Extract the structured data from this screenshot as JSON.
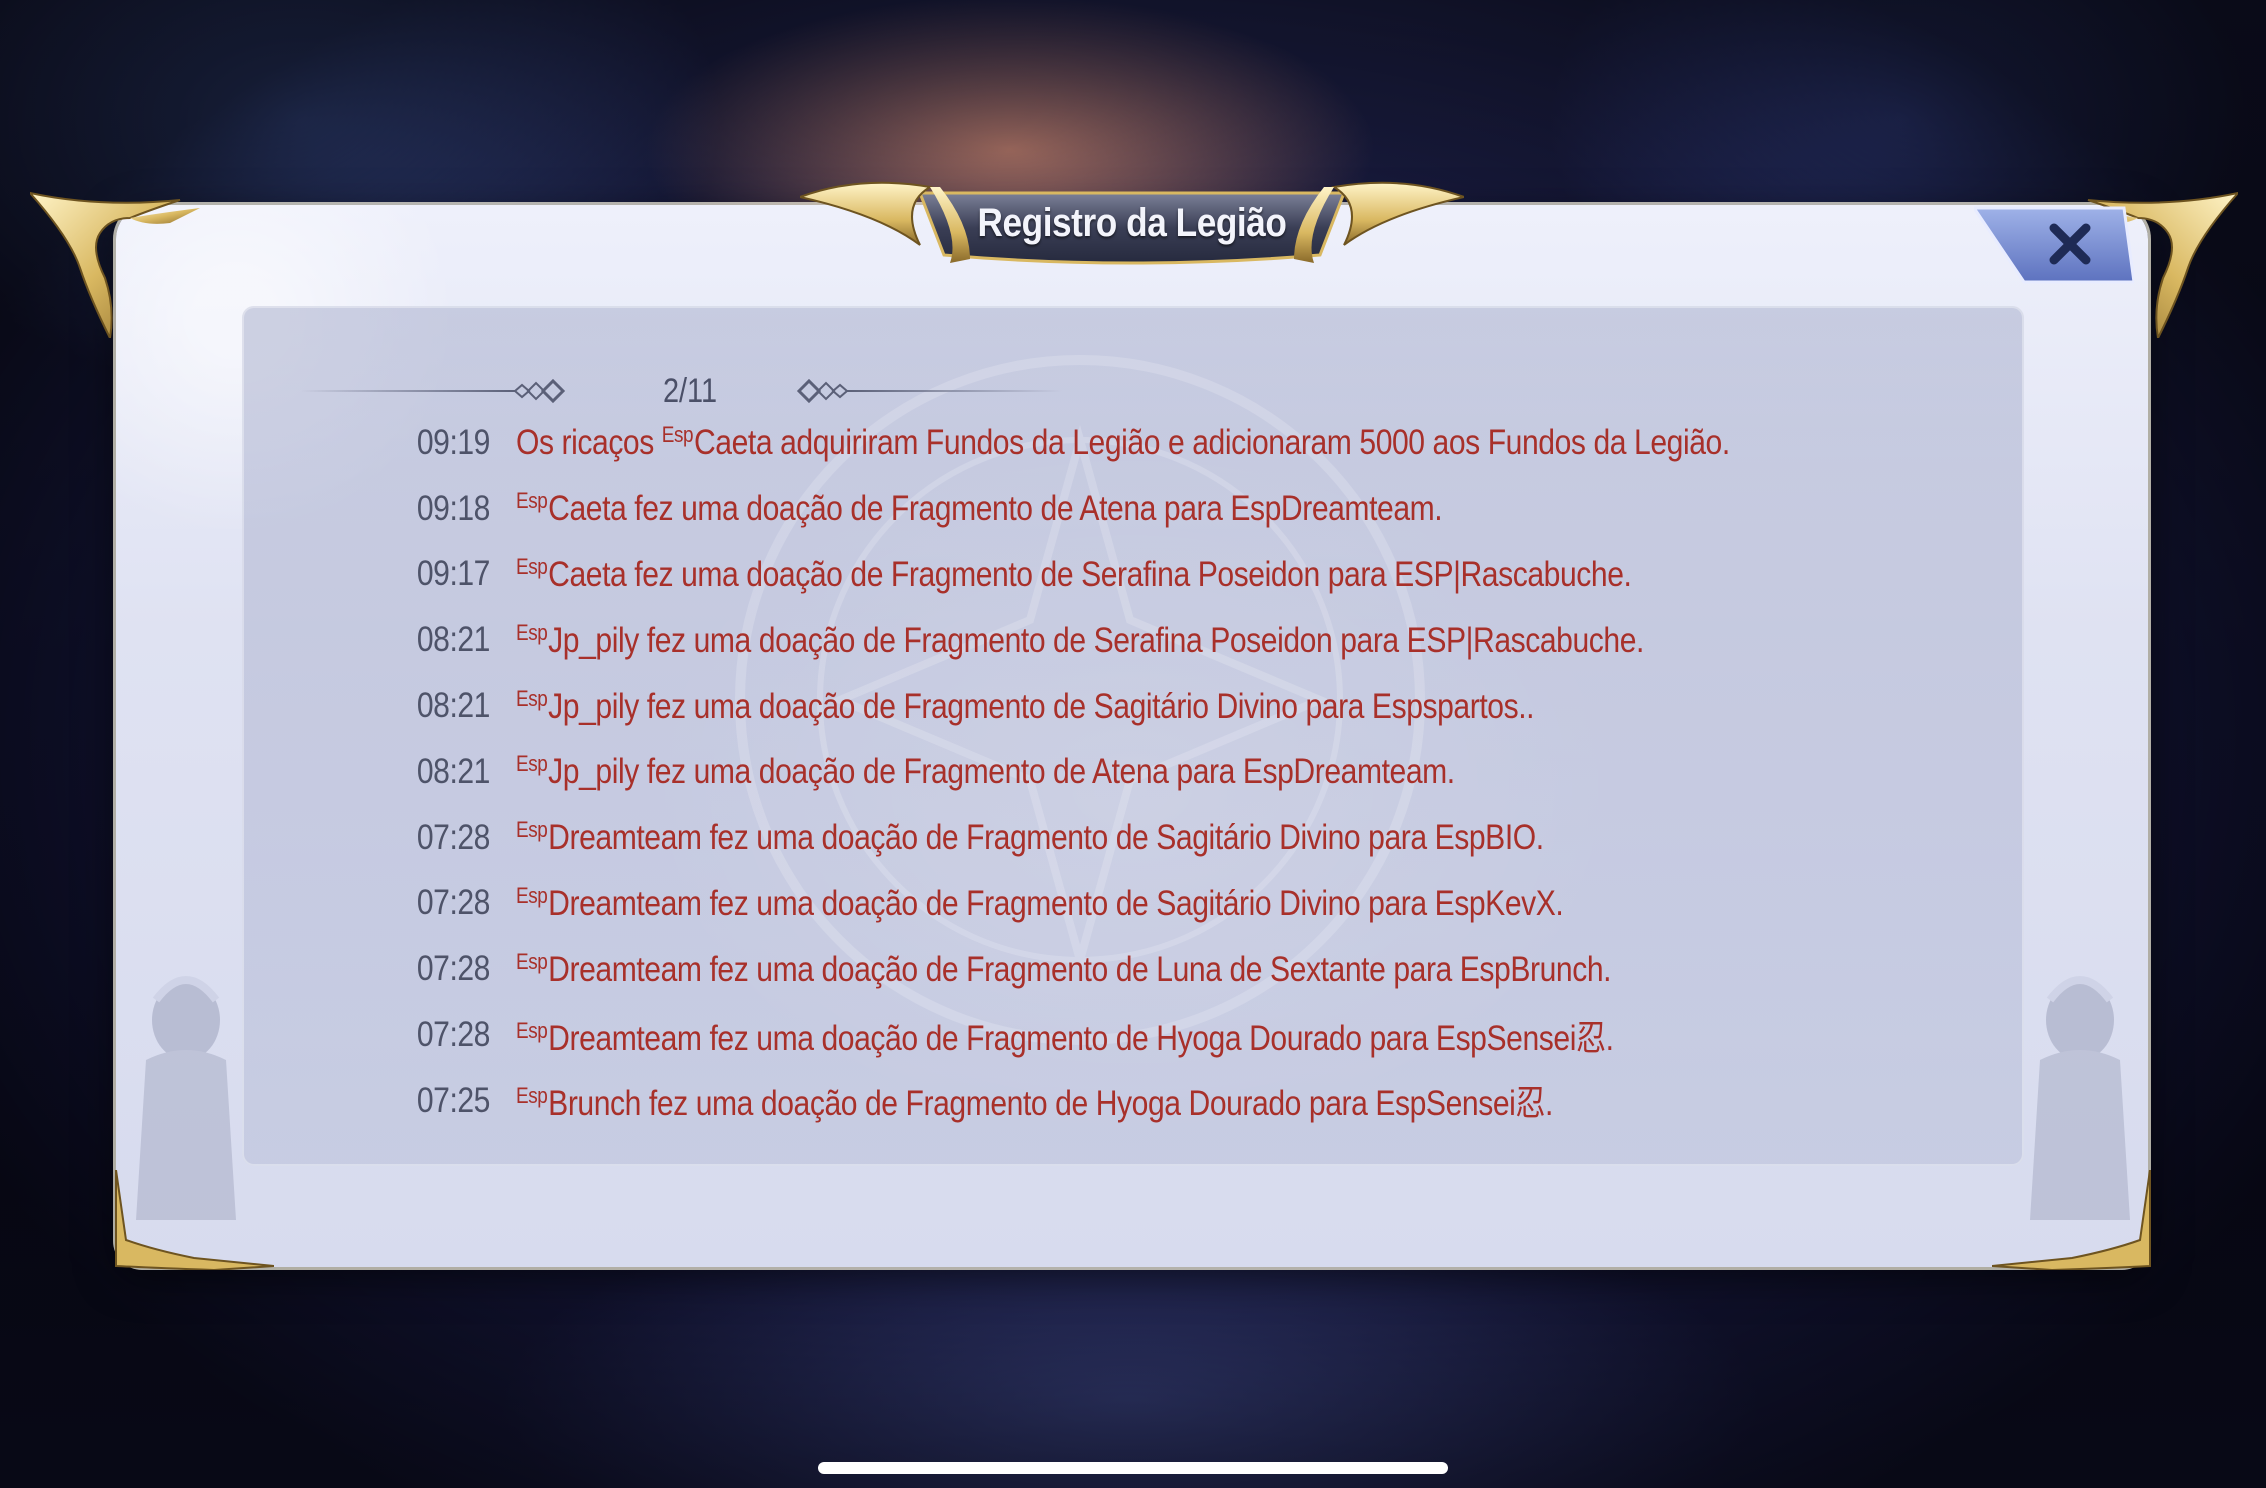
{
  "dialog": {
    "title": "Registro da Legião",
    "close_icon": "close-x-icon",
    "page_indicator": "2/11"
  },
  "log": [
    {
      "time": "09:19",
      "pre": "Os ricaços ",
      "tag": "Esp",
      "text": "Caeta adquiriram Fundos da Legião e adicionaram 5000 aos Fundos da Legião."
    },
    {
      "time": "09:18",
      "pre": "",
      "tag": "Esp",
      "text": "Caeta fez uma doação de Fragmento de Atena para EspDreamteam."
    },
    {
      "time": "09:17",
      "pre": "",
      "tag": "Esp",
      "text": "Caeta fez uma doação de Fragmento de Serafina Poseidon para ESP|Rascabuche."
    },
    {
      "time": "08:21",
      "pre": "",
      "tag": "Esp",
      "text": "Jp_pily fez uma doação de Fragmento de Serafina Poseidon para ESP|Rascabuche."
    },
    {
      "time": "08:21",
      "pre": "",
      "tag": "Esp",
      "text": "Jp_pily fez uma doação de Fragmento de Sagitário Divino para Espspartos.."
    },
    {
      "time": "08:21",
      "pre": "",
      "tag": "Esp",
      "text": "Jp_pily fez uma doação de Fragmento de Atena para EspDreamteam."
    },
    {
      "time": "07:28",
      "pre": "",
      "tag": "Esp",
      "text": "Dreamteam fez uma doação de Fragmento de Sagitário Divino para EspBIO."
    },
    {
      "time": "07:28",
      "pre": "",
      "tag": "Esp",
      "text": "Dreamteam fez uma doação de Fragmento de Sagitário Divino para EspKevX."
    },
    {
      "time": "07:28",
      "pre": "",
      "tag": "Esp",
      "text": "Dreamteam fez uma doação de Fragmento de Luna de Sextante para EspBrunch."
    },
    {
      "time": "07:28",
      "pre": "",
      "tag": "Esp",
      "text": "Dreamteam fez uma doação de Fragmento de Hyoga Dourado para EspSensei忍."
    },
    {
      "time": "07:25",
      "pre": "",
      "tag": "Esp",
      "text": "Brunch fez uma doação de Fragmento de Hyoga Dourado para EspSensei忍."
    }
  ],
  "colors": {
    "message_red": "#a8302a",
    "time_gray": "#4e5369",
    "gold_trim": "#d9b861"
  }
}
